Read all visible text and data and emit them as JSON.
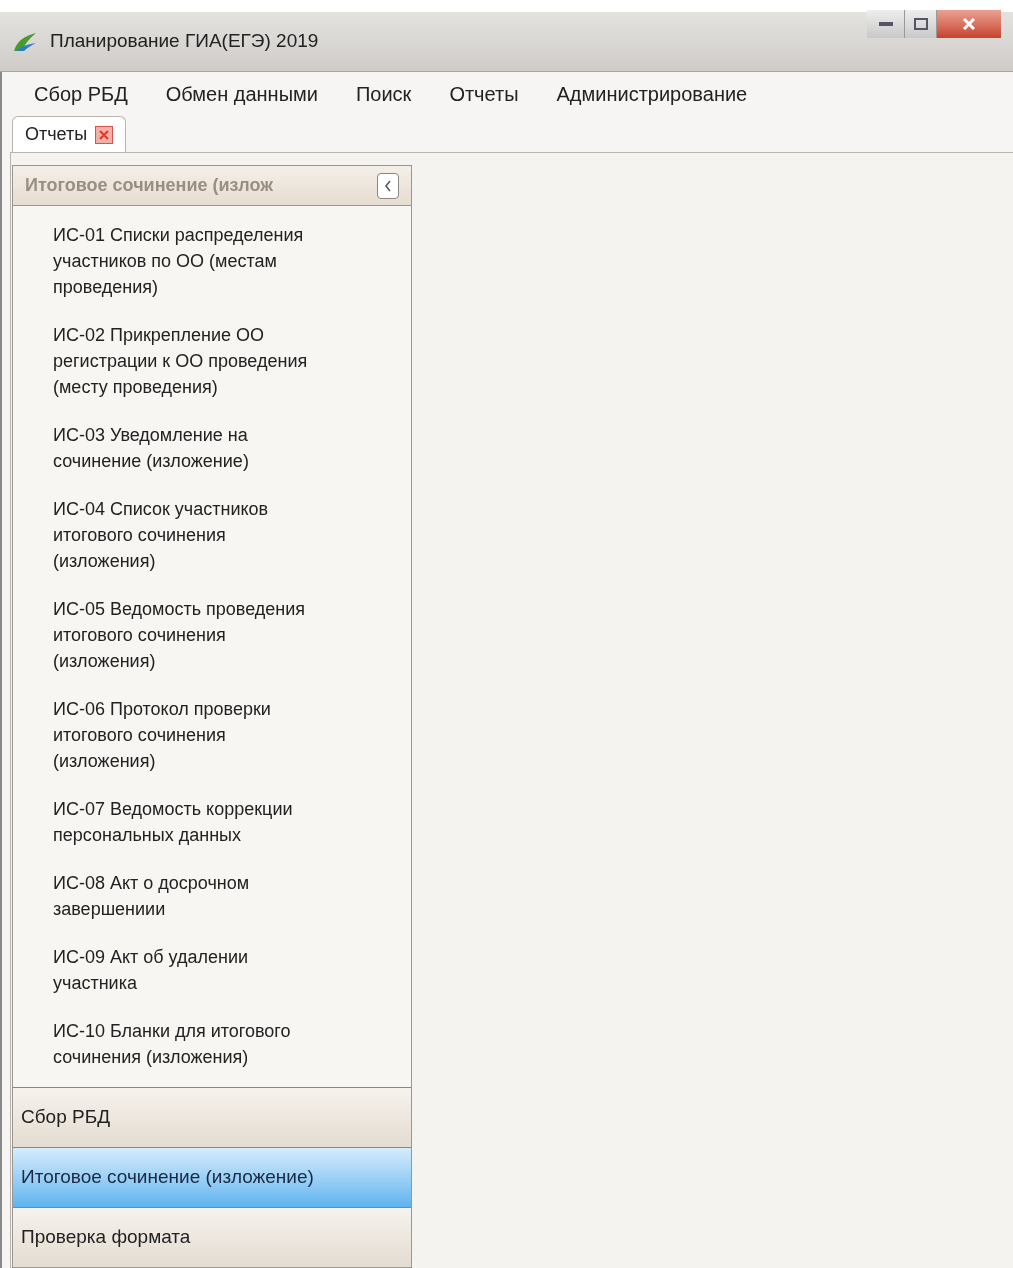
{
  "window": {
    "title": "Планирование ГИА(ЕГЭ) 2019"
  },
  "menu": [
    "Сбор РБД",
    "Обмен данными",
    "Поиск",
    "Отчеты",
    "Администрирование"
  ],
  "tabs": [
    {
      "label": "Отчеты",
      "selected": true
    }
  ],
  "sidebar": {
    "header": "Итоговое сочинение (излож",
    "reports": [
      "ИС-01 Списки распределения участников по ОО (местам проведения)",
      "ИС-02 Прикрепление ОО регистрации к ОО проведения (месту проведения)",
      "ИС-03 Уведомление на сочинение (изложение)",
      "ИС-04 Список участников итогового сочинения (изложения)",
      "ИС-05 Ведомость проведения итогового сочинения (изложения)",
      "ИС-06 Протокол проверки итогового сочинения (изложения)",
      "ИС-07 Ведомость коррекции персональных данных",
      "ИС-08 Акт о досрочном завершениии",
      "ИС-09 Акт об удалении участника",
      "ИС-10 Бланки для итогового сочинения (изложения)"
    ],
    "groups": [
      {
        "label": "Сбор РБД",
        "selected": false
      },
      {
        "label": "Итоговое сочинение (изложение)",
        "selected": true
      },
      {
        "label": "Проверка формата",
        "selected": false
      }
    ]
  }
}
